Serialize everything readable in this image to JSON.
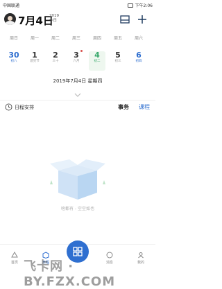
{
  "status_bar": {
    "carrier": "中国联通",
    "time": "下午2:06"
  },
  "header": {
    "date": "7月4日",
    "year": "2019",
    "today_label": "今日",
    "icons": [
      "list-icon",
      "plus-icon"
    ]
  },
  "week": {
    "labels": [
      "周日",
      "周一",
      "周二",
      "周三",
      "周四",
      "周五",
      "周六"
    ],
    "days": [
      {
        "num": "30",
        "lunar": "初八"
      },
      {
        "num": "1",
        "lunar": "建党节"
      },
      {
        "num": "2",
        "lunar": "三十"
      },
      {
        "num": "3",
        "lunar": "六月"
      },
      {
        "num": "4",
        "lunar": "初二"
      },
      {
        "num": "5",
        "lunar": "初三"
      },
      {
        "num": "6",
        "lunar": "初四"
      }
    ]
  },
  "full_date": "2019年7月4日 星期四",
  "schedule": {
    "title": "日程安排",
    "tab_event": "事务",
    "tab_course": "课程"
  },
  "empty_state": {
    "text": "啥都有 - 空空如也"
  },
  "bottom_nav": [
    {
      "label": "首页",
      "icon": "home-icon"
    },
    {
      "label": "日程",
      "icon": "box-icon"
    },
    {
      "label": "",
      "icon": "apps-icon"
    },
    {
      "label": "消息",
      "icon": "message-icon"
    },
    {
      "label": "我的",
      "icon": "person-icon"
    }
  ],
  "watermark": "飞卡网 · BY.FZX.COM",
  "colors": {
    "accent": "#2f6fd0",
    "green": "#37a86b",
    "header_icon": "#1e3a5f"
  }
}
